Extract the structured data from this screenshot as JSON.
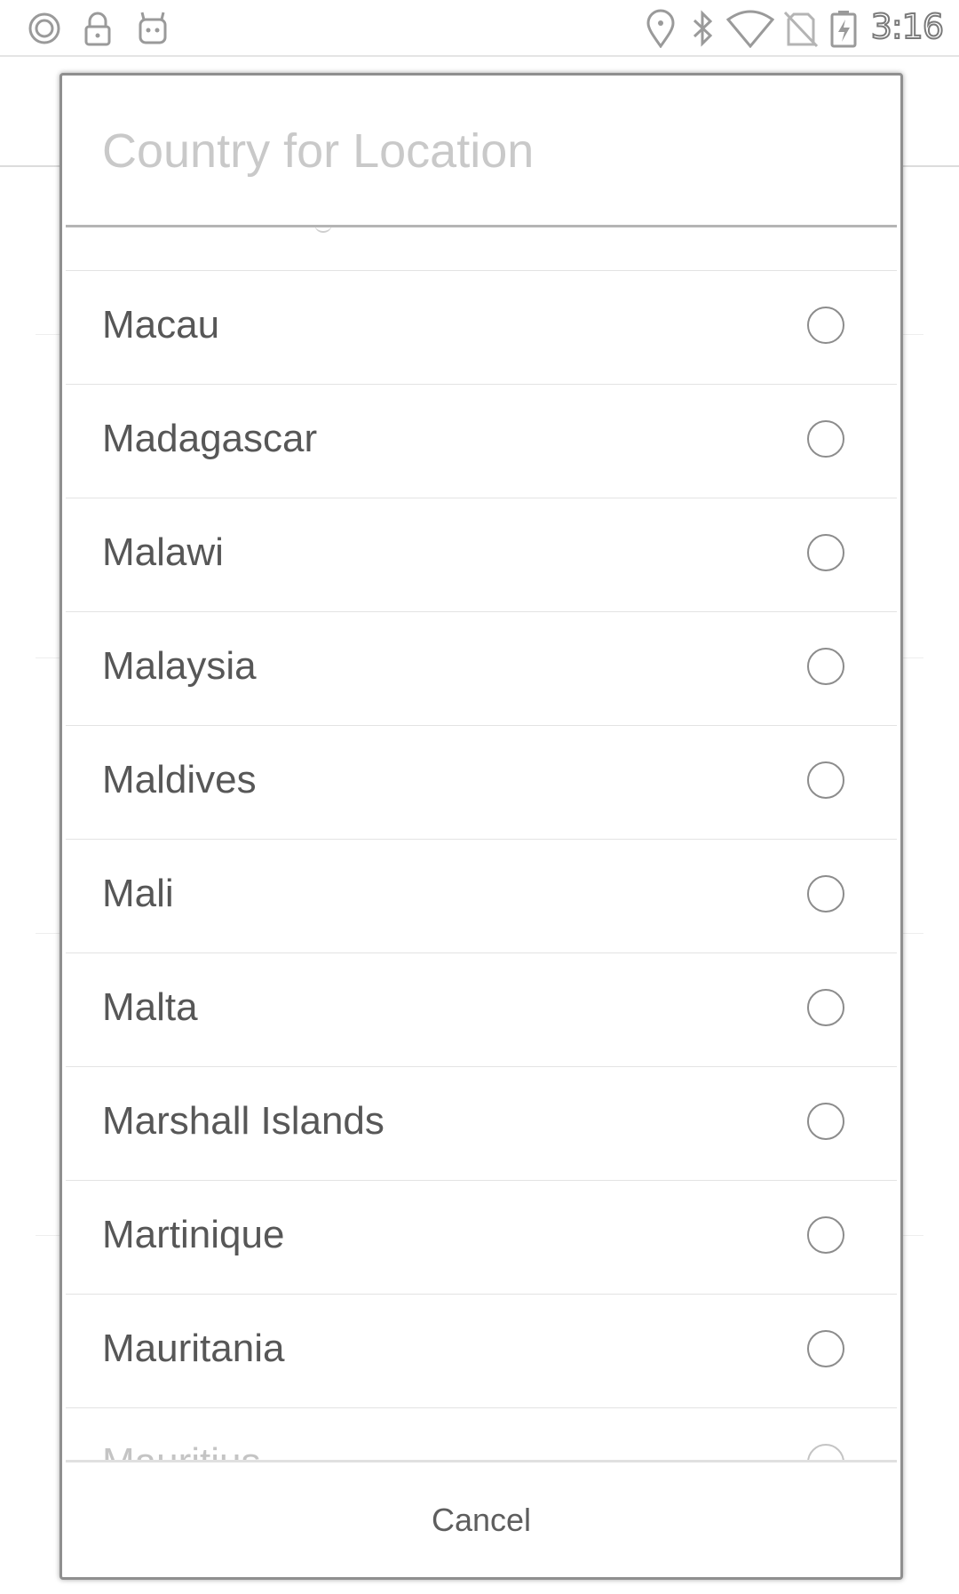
{
  "status_bar": {
    "time": "3:16",
    "left_icons": [
      "circle-icon",
      "lock-icon",
      "android-icon"
    ],
    "right_icons": [
      "location-icon",
      "bluetooth-icon",
      "wifi-icon",
      "no-sim-icon",
      "battery-charging-icon"
    ]
  },
  "dialog": {
    "title": "Country for Location",
    "countries": [
      {
        "name": "Macau",
        "selected": false
      },
      {
        "name": "Madagascar",
        "selected": false
      },
      {
        "name": "Malawi",
        "selected": false
      },
      {
        "name": "Malaysia",
        "selected": false
      },
      {
        "name": "Maldives",
        "selected": false
      },
      {
        "name": "Mali",
        "selected": false
      },
      {
        "name": "Malta",
        "selected": false
      },
      {
        "name": "Marshall Islands",
        "selected": false
      },
      {
        "name": "Martinique",
        "selected": false
      },
      {
        "name": "Mauritania",
        "selected": false
      },
      {
        "name": "Mauritius",
        "selected": false
      }
    ],
    "cancel_label": "Cancel"
  },
  "colors": {
    "title": "#c9c9c9",
    "item_text": "#575757",
    "radio": "#8c8c8c",
    "divider": "#e3e3e3"
  }
}
